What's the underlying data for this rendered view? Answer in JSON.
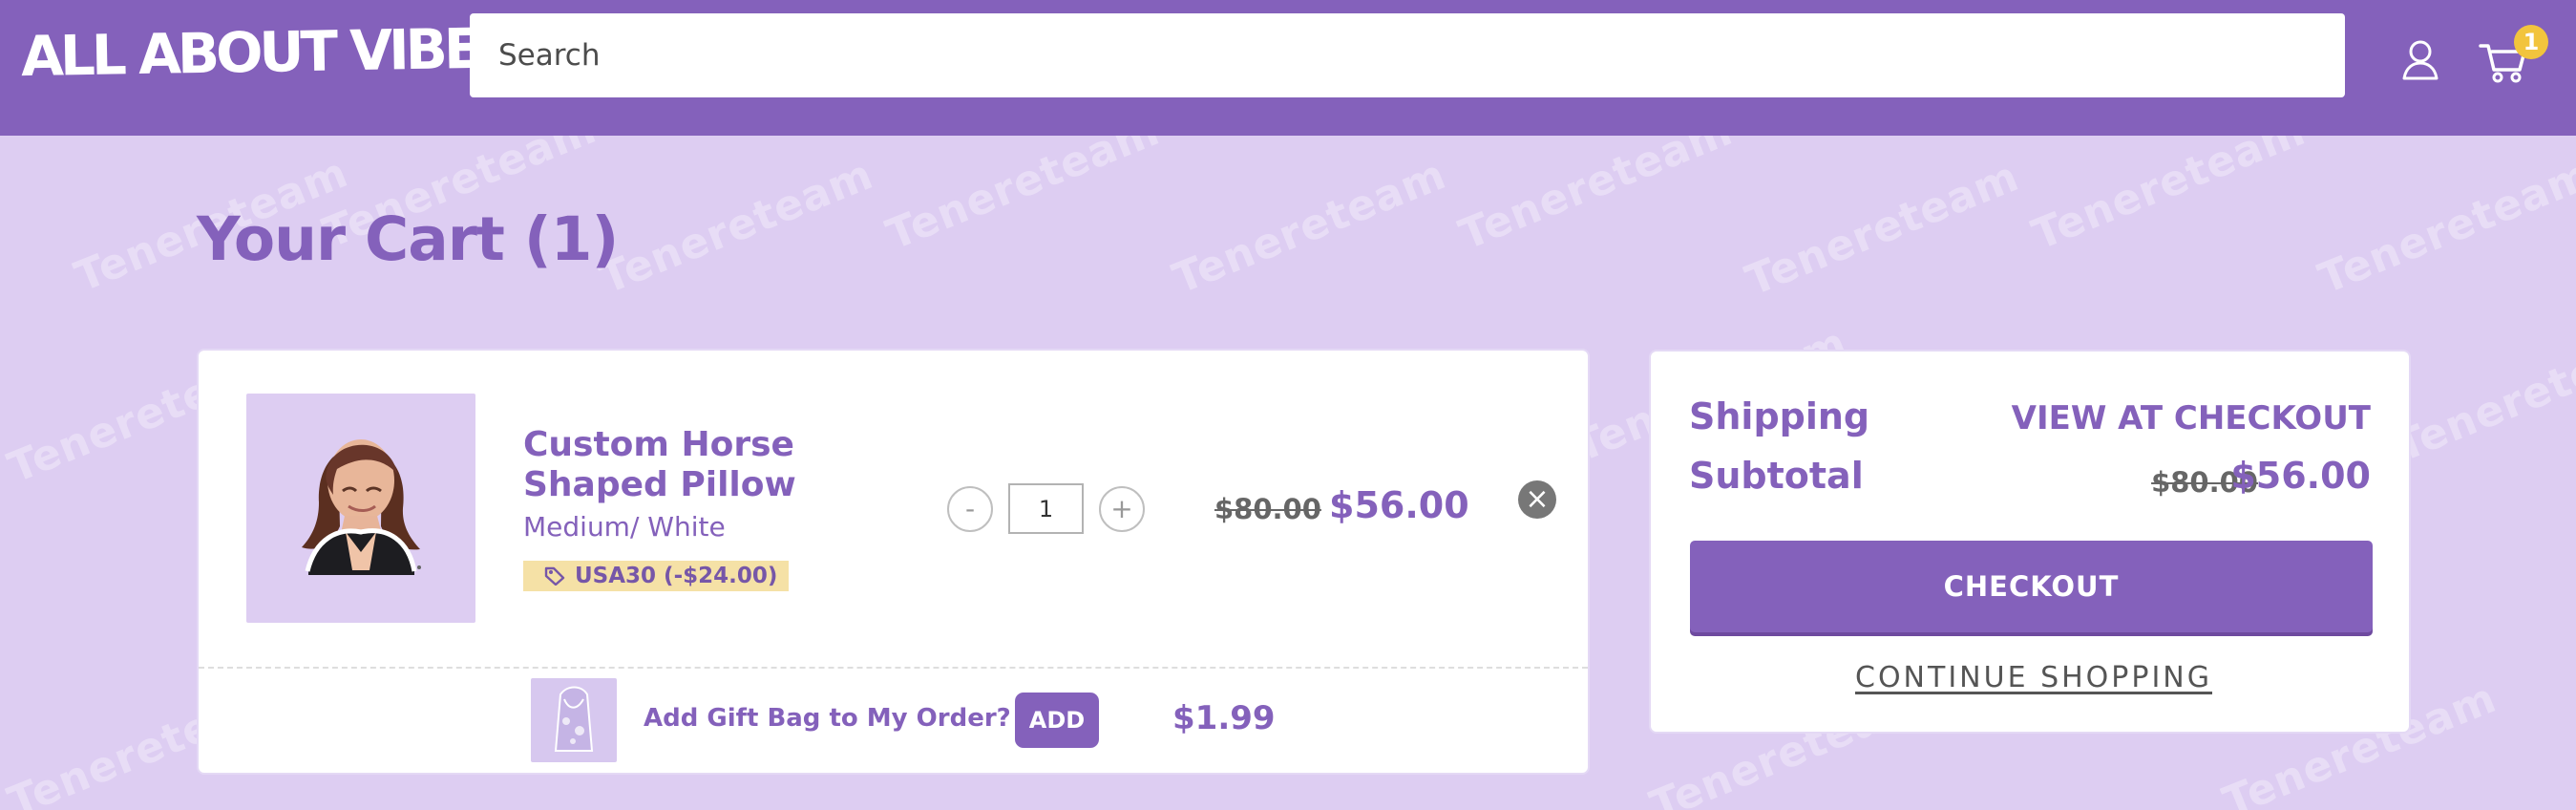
{
  "brand": {
    "name": "ALL ABOUT VIBE"
  },
  "header": {
    "search_placeholder": "Search",
    "cart_count": "1",
    "account_icon": "user-icon",
    "cart_icon": "shopping-cart-icon"
  },
  "watermark": {
    "text": "Tenereteam"
  },
  "cart": {
    "title": "Your Cart (1)",
    "item": {
      "name": "Custom Horse Shaped Pillow",
      "variant": "Medium/ White",
      "discount": "USA30 (-$24.00)",
      "quantity": "1",
      "decrement_label": "-",
      "increment_label": "+",
      "original_price": "$80.00",
      "sale_price": "$56.00",
      "remove_label": "×"
    },
    "gift": {
      "label": "Add Gift Bag to My Order?",
      "button": "ADD",
      "price": "$1.99"
    }
  },
  "summary": {
    "shipping_label": "Shipping",
    "shipping_value": "VIEW AT CHECKOUT",
    "subtotal_label": "Subtotal",
    "subtotal_original": "$80.00",
    "subtotal_sale": "$56.00",
    "checkout_button": "CHECKOUT",
    "continue_link": "CONTINUE SHOPPING"
  },
  "colors": {
    "primary": "#8461bb",
    "background": "#ddcdf2",
    "badge": "#f2c43d",
    "discount_background": "#f5e1a6"
  }
}
